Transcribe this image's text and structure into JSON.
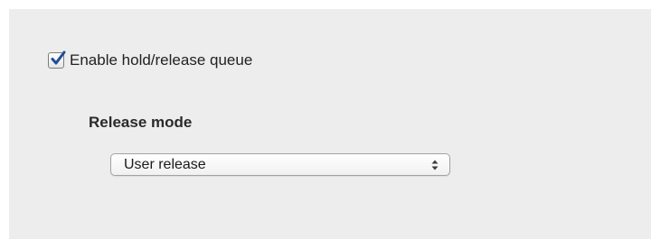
{
  "hold_release": {
    "checkbox": {
      "label": "Enable hold/release queue",
      "checked": true
    },
    "release_mode": {
      "label": "Release mode",
      "selected": "User release"
    }
  },
  "colors": {
    "panel_background": "#ededed",
    "checkmark": "#1e4f9a",
    "text": "#222222"
  },
  "icons": {
    "checkmark": "checkmark-icon",
    "select_arrows": "up-down-arrows-icon"
  }
}
